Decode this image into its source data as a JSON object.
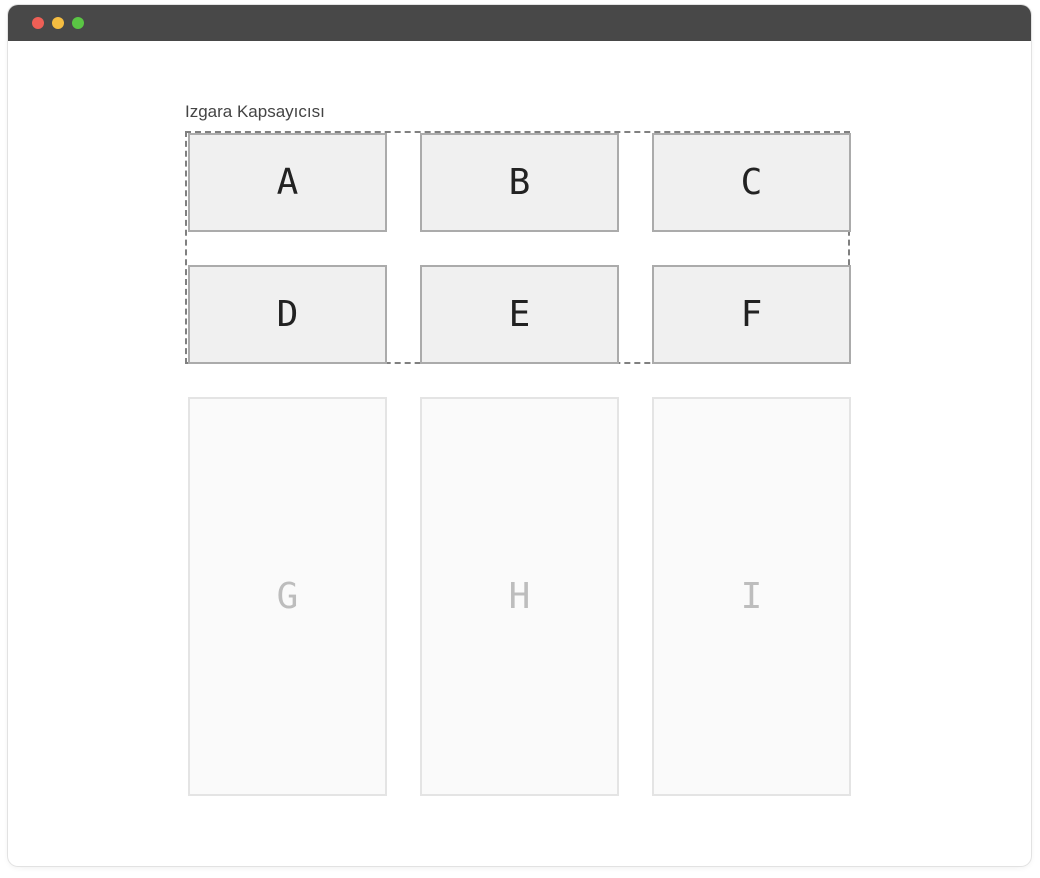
{
  "window": {
    "controls": [
      "close",
      "minimize",
      "maximize"
    ],
    "colors": {
      "close": "#ee5f56",
      "minimize": "#f5bd41",
      "maximize": "#5ac544",
      "titlebar": "#484848"
    }
  },
  "container_label": "Izgara Kapsayıcısı",
  "grid_items": [
    "A",
    "B",
    "C",
    "D",
    "E",
    "F"
  ],
  "overflow_items": [
    "G",
    "H",
    "I"
  ]
}
